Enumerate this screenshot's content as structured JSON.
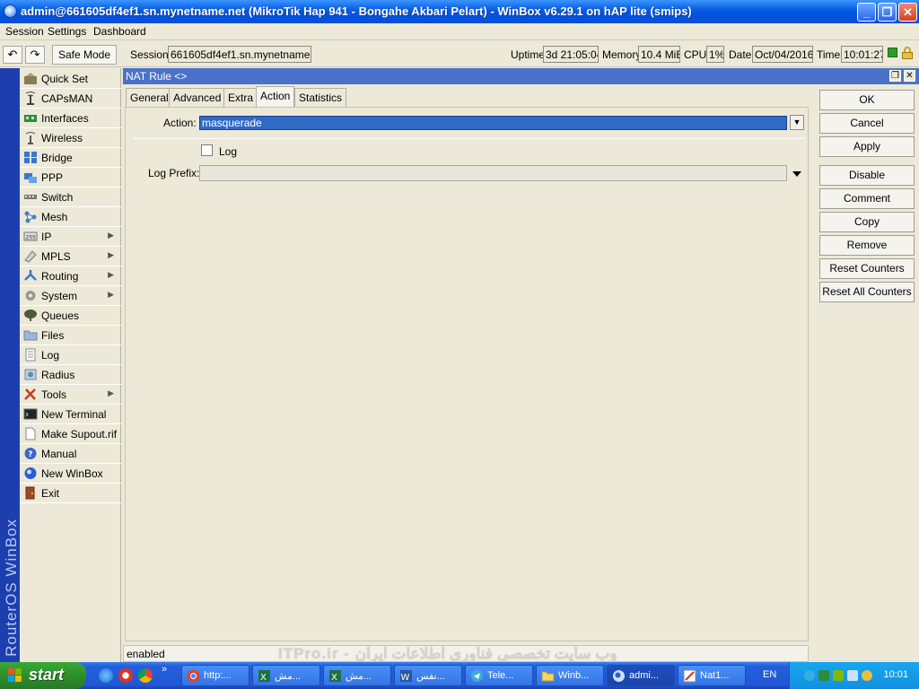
{
  "window": {
    "title": "admin@661605df4ef1.sn.mynetname.net (MikroTik Hap 941 - Bongahe Akbari Pelart) - WinBox v6.29.1 on hAP lite (smips)",
    "minimize": "_",
    "maximize": "❐",
    "close": "✕"
  },
  "menu": [
    "Session",
    "Settings",
    "Dashboard"
  ],
  "toolbar": {
    "undo": "↶",
    "redo": "↷",
    "safe_mode": "Safe Mode",
    "session_label": "Session:",
    "session_value": "661605df4ef1.sn.mynetname.net",
    "uptime_label": "Uptime:",
    "uptime_value": "3d 21:05:04",
    "memory_label": "Memory:",
    "memory_value": "10.4 MiB",
    "cpu_label": "CPU:",
    "cpu_value": "1%",
    "date_label": "Date:",
    "date_value": "Oct/04/2016",
    "time_label": "Time:",
    "time_value": "10:01:27"
  },
  "vertical_brand": "RouterOS WinBox",
  "sidebar": {
    "items": [
      {
        "label": "Quick Set",
        "icon": "quickset-icon",
        "submenu": false
      },
      {
        "label": "CAPsMAN",
        "icon": "capsman-icon",
        "submenu": false
      },
      {
        "label": "Interfaces",
        "icon": "interfaces-icon",
        "submenu": false
      },
      {
        "label": "Wireless",
        "icon": "wireless-icon",
        "submenu": false
      },
      {
        "label": "Bridge",
        "icon": "bridge-icon",
        "submenu": false
      },
      {
        "label": "PPP",
        "icon": "ppp-icon",
        "submenu": false
      },
      {
        "label": "Switch",
        "icon": "switch-icon",
        "submenu": false
      },
      {
        "label": "Mesh",
        "icon": "mesh-icon",
        "submenu": false
      },
      {
        "label": "IP",
        "icon": "ip-icon",
        "submenu": true
      },
      {
        "label": "MPLS",
        "icon": "mpls-icon",
        "submenu": true
      },
      {
        "label": "Routing",
        "icon": "routing-icon",
        "submenu": true
      },
      {
        "label": "System",
        "icon": "system-icon",
        "submenu": true
      },
      {
        "label": "Queues",
        "icon": "queues-icon",
        "submenu": false
      },
      {
        "label": "Files",
        "icon": "files-icon",
        "submenu": false
      },
      {
        "label": "Log",
        "icon": "log-icon",
        "submenu": false
      },
      {
        "label": "Radius",
        "icon": "radius-icon",
        "submenu": false
      },
      {
        "label": "Tools",
        "icon": "tools-icon",
        "submenu": true
      },
      {
        "label": "New Terminal",
        "icon": "terminal-icon",
        "submenu": false
      },
      {
        "label": "Make Supout.rif",
        "icon": "supout-icon",
        "submenu": false
      },
      {
        "label": "Manual",
        "icon": "manual-icon",
        "submenu": false
      },
      {
        "label": "New WinBox",
        "icon": "winbox-icon",
        "submenu": false
      },
      {
        "label": "Exit",
        "icon": "exit-icon",
        "submenu": false
      }
    ]
  },
  "nat_window": {
    "title": "NAT Rule <>",
    "restore": "❐",
    "close": "✕",
    "tabs": [
      "General",
      "Advanced",
      "Extra",
      "Action",
      "Statistics"
    ],
    "active_tab": "Action",
    "action_label": "Action:",
    "action_value": "masquerade",
    "log_label": "Log",
    "log_checked": false,
    "log_prefix_label": "Log Prefix:",
    "log_prefix_value": "",
    "buttons": [
      "OK",
      "Cancel",
      "Apply",
      "Disable",
      "Comment",
      "Copy",
      "Remove",
      "Reset Counters",
      "Reset All Counters"
    ],
    "status": "enabled"
  },
  "watermark": "ITPro.ir - وب سایت تخصصی فناوری اطلاعات ایران",
  "taskbar": {
    "start": "start",
    "tasks": [
      {
        "label": "http:...",
        "icon": "chrome-icon",
        "active": false
      },
      {
        "label": "مش...",
        "icon": "excel-icon",
        "active": false
      },
      {
        "label": "مش...",
        "icon": "excel-icon",
        "active": false
      },
      {
        "label": "نفس...",
        "icon": "word-icon",
        "active": false
      },
      {
        "label": "Tele...",
        "icon": "telegram-icon",
        "active": false
      },
      {
        "label": "Winb...",
        "icon": "folder-icon",
        "active": false
      },
      {
        "label": "admi...",
        "icon": "winbox-icon",
        "active": true
      },
      {
        "label": "Nat1...",
        "icon": "paint-icon",
        "active": false
      }
    ],
    "lang": "EN",
    "clock": "10:01"
  }
}
